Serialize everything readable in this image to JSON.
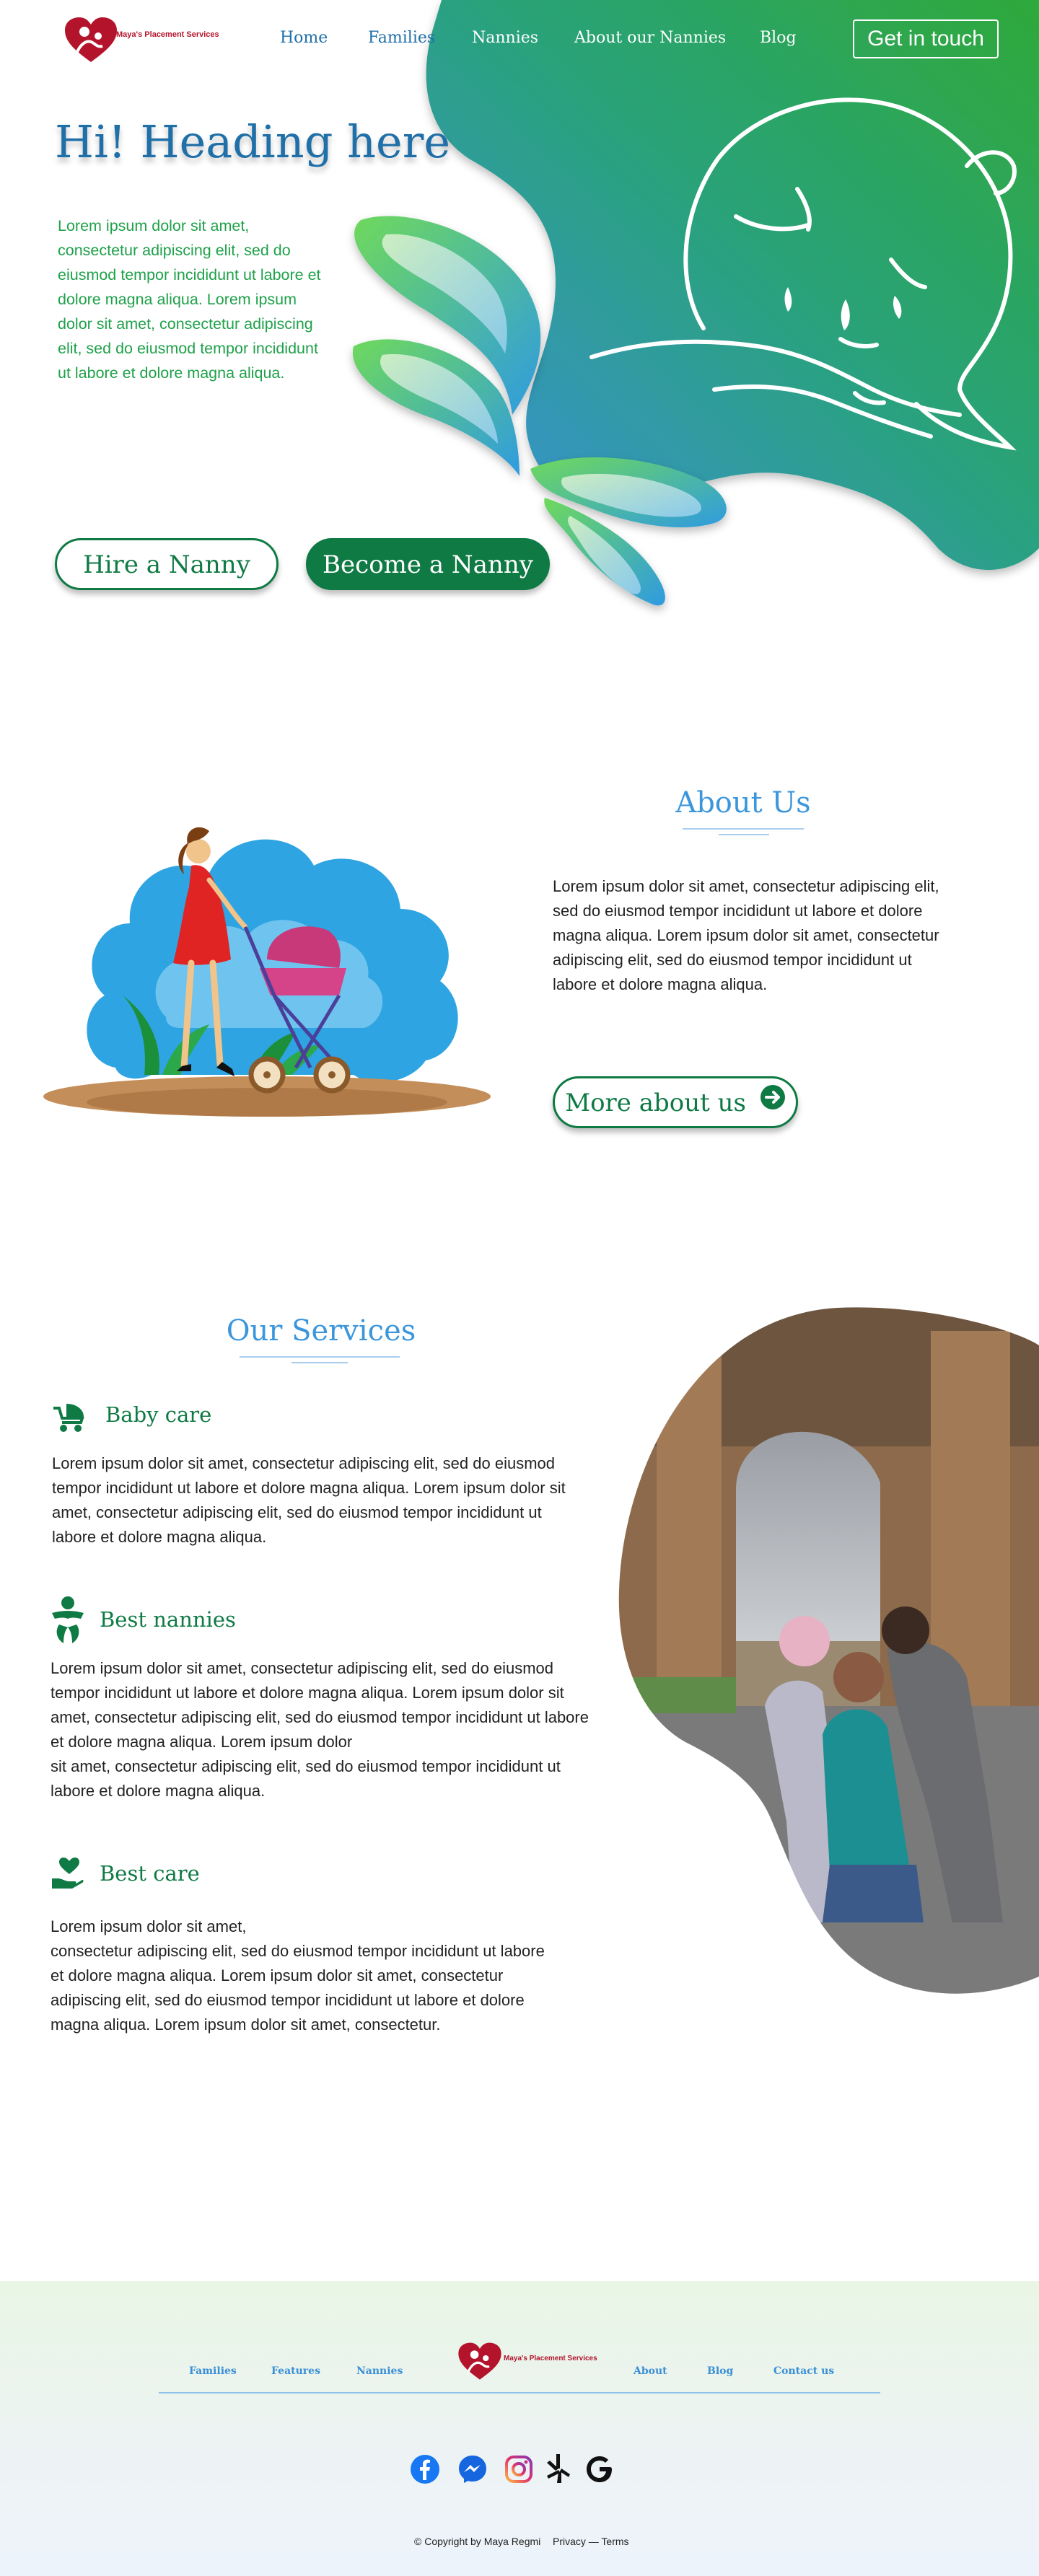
{
  "brand": {
    "name": "Maya's Placement Services"
  },
  "nav": {
    "items": [
      "Home",
      "Families",
      "Nannies",
      "About our Nannies",
      "Blog"
    ],
    "cta": "Get in touch"
  },
  "hero": {
    "title": "Hi! Heading here",
    "text": "Lorem ipsum dolor sit amet, consectetur adipiscing elit, sed do eiusmod tempor incididunt ut labore et dolore magna aliqua. Lorem ipsum dolor sit amet, consectetur adipiscing elit, sed do eiusmod tempor incididunt ut labore et dolore magna aliqua.",
    "hire_button": "Hire a Nanny",
    "become_button": "Become a Nanny"
  },
  "about": {
    "title": "About Us",
    "text": "Lorem ipsum dolor sit amet, consectetur adipiscing elit, sed do eiusmod tempor incididunt ut labore et dolore magna aliqua. Lorem ipsum dolor sit amet, consectetur adipiscing elit, sed do eiusmod tempor incididunt ut labore et dolore magna aliqua.",
    "button": "More about us"
  },
  "services": {
    "title": "Our Services",
    "items": [
      {
        "icon": "stroller-icon",
        "title": "Baby care",
        "text": "Lorem ipsum dolor sit amet, consectetur adipiscing elit, sed do eiusmod tempor incididunt ut labore et dolore magna aliqua. Lorem ipsum dolor sit amet, consectetur adipiscing elit, sed  do eiusmod tempor incididunt ut labore et dolore magna aliqua."
      },
      {
        "icon": "baby-icon",
        "title": "Best nannies",
        "text": "Lorem ipsum dolor sit amet, consectetur adipiscing elit, sed do eiusmod tempor incididunt ut labore et dolore magna aliqua. Lorem ipsum dolor sit amet, consectetur adipiscing elit, sed do eiusmod tempor incididunt ut labore et dolore magna aliqua. Lorem ipsum dolor\nsit amet, consectetur adipiscing elit, sed do eiusmod tempor incididunt ut labore et dolore magna aliqua."
      },
      {
        "icon": "heart-hand-icon",
        "title": "Best care",
        "text": "Lorem ipsum dolor sit amet,\nconsectetur adipiscing elit, sed do eiusmod tempor incididunt ut labore et dolore magna aliqua. Lorem ipsum dolor sit amet, consectetur adipiscing elit, sed do eiusmod tempor incididunt ut labore et dolore magna aliqua. Lorem ipsum dolor sit amet, consectetur."
      }
    ]
  },
  "footer": {
    "left_links": [
      "Families",
      "Features",
      "Nannies"
    ],
    "right_links": [
      "About",
      "Blog",
      "Contact us"
    ],
    "social": [
      "facebook-icon",
      "messenger-icon",
      "instagram-icon",
      "yelp-icon",
      "google-icon"
    ],
    "copyright": "© Copyright by Maya Regmi",
    "legal": "Privacy — Terms"
  },
  "colors": {
    "primary_green": "#0f7a44",
    "accent_blue": "#3b96dc",
    "heading_blue": "#1f6fa8",
    "logo_red": "#b3142b"
  }
}
